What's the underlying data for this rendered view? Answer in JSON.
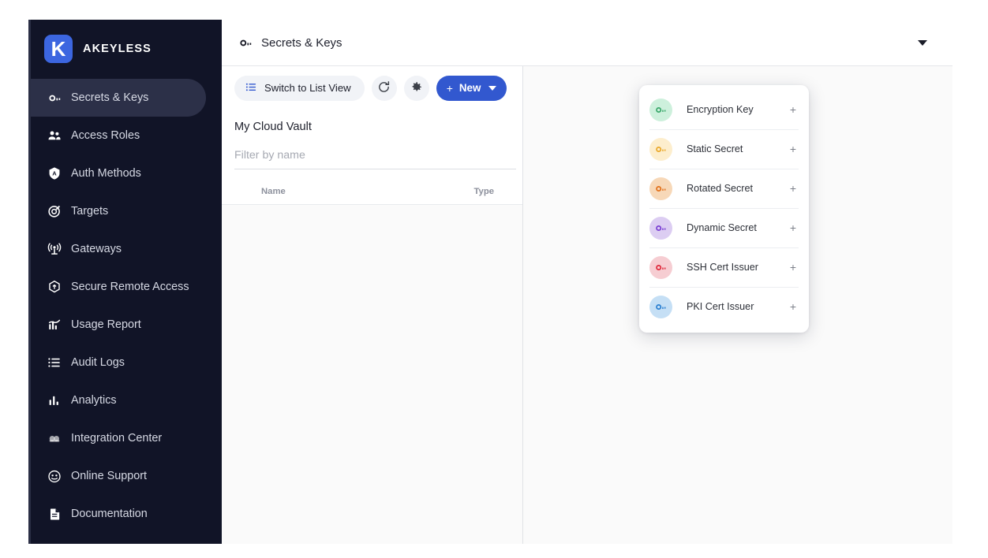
{
  "brand": {
    "name": "AKEYLESS",
    "mark_letter": "K",
    "mark_color": "#3c66e0"
  },
  "sidebar": {
    "items": [
      {
        "label": "Secrets & Keys",
        "icon": "key-icon",
        "active": true
      },
      {
        "label": "Access Roles",
        "icon": "users-icon",
        "active": false
      },
      {
        "label": "Auth Methods",
        "icon": "badge-a-icon",
        "active": false
      },
      {
        "label": "Targets",
        "icon": "target-icon",
        "active": false
      },
      {
        "label": "Gateways",
        "icon": "broadcast-icon",
        "active": false
      },
      {
        "label": "Secure Remote Access",
        "icon": "hexagon-arrow-icon",
        "active": false
      },
      {
        "label": "Usage Report",
        "icon": "usage-chart-icon",
        "active": false
      },
      {
        "label": "Audit Logs",
        "icon": "list-icon",
        "active": false
      },
      {
        "label": "Analytics",
        "icon": "bar-chart-icon",
        "active": false
      },
      {
        "label": "Integration Center",
        "icon": "cloud-icon",
        "active": false
      },
      {
        "label": "Online Support",
        "icon": "support-face-icon",
        "active": false
      },
      {
        "label": "Documentation",
        "icon": "document-icon",
        "active": false
      }
    ]
  },
  "topbar": {
    "title": "Secrets & Keys",
    "title_icon": "key-icon",
    "account_caret_icon": "chevron-down-icon"
  },
  "toolbar": {
    "switch_view_label": "Switch to List View",
    "switch_view_icon": "list-view-icon",
    "refresh_icon": "refresh-icon",
    "settings_icon": "gear-icon",
    "new_label": "New",
    "new_plus": "+",
    "new_caret_icon": "chevron-down-icon",
    "new_button_color": "#3258cf"
  },
  "left_pane": {
    "vault_title": "My Cloud Vault",
    "filter_placeholder": "Filter by name",
    "filter_value": "",
    "columns": [
      "Name",
      "Type"
    ],
    "rows": []
  },
  "new_menu": {
    "items": [
      {
        "label": "Encryption Key",
        "icon": "key-icon",
        "plus": "+",
        "bg": "#cdf0dc",
        "fg": "#3aa86b"
      },
      {
        "label": "Static Secret",
        "icon": "key-icon",
        "plus": "+",
        "bg": "#fdeecd",
        "fg": "#eaa82a"
      },
      {
        "label": "Rotated Secret",
        "icon": "key-icon",
        "plus": "+",
        "bg": "#f7d8b8",
        "fg": "#e2701a"
      },
      {
        "label": "Dynamic Secret",
        "icon": "key-icon",
        "plus": "+",
        "bg": "#dccdf2",
        "fg": "#7a3ed3"
      },
      {
        "label": "SSH Cert Issuer",
        "icon": "key-icon",
        "plus": "+",
        "bg": "#f6cdd2",
        "fg": "#e02a3c"
      },
      {
        "label": "PKI Cert Issuer",
        "icon": "key-icon",
        "plus": "+",
        "bg": "#c5dff5",
        "fg": "#2a7fd1"
      }
    ]
  }
}
